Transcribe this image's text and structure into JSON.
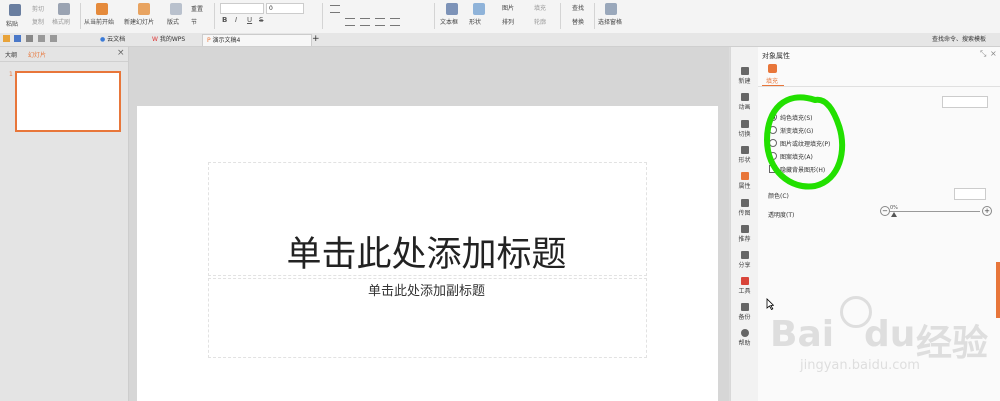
{
  "ribbon": {
    "paste": "粘贴",
    "cut": "剪切",
    "copy": "复制",
    "format_painter": "格式刷",
    "from_current": "从当前开始",
    "new_slide": "新建幻灯片",
    "layout": "版式",
    "section": "节",
    "reset": "重置",
    "font_size": "0",
    "bold": "B",
    "italic": "I",
    "underline": "U",
    "strike": "S",
    "textbox": "文本框",
    "shape": "形状",
    "picture": "图片",
    "fill": "填充",
    "arrange": "排列",
    "outline": "轮廓",
    "find": "查找",
    "replace": "替换",
    "select_pane": "选择窗格"
  },
  "tabbar": {
    "tabs": [
      {
        "label": "云文档"
      },
      {
        "label": "我的WPS"
      },
      {
        "label": "演示文稿4"
      }
    ],
    "add": "+",
    "search": "查找命令、搜索模板"
  },
  "leftpane": {
    "tab_outline": "大纲",
    "tab_slides": "幻灯片",
    "slide_number": "1",
    "close": "×"
  },
  "slide": {
    "title": "单击此处添加标题",
    "subtitle": "单击此处添加副标题"
  },
  "sidetools": [
    {
      "label": "新建"
    },
    {
      "label": "动画"
    },
    {
      "label": "切换"
    },
    {
      "label": "形状"
    },
    {
      "label": "属性"
    },
    {
      "label": "传图"
    },
    {
      "label": "推荐"
    },
    {
      "label": "分享"
    },
    {
      "label": "工具"
    },
    {
      "label": "备份"
    },
    {
      "label": "帮助"
    }
  ],
  "panel": {
    "title": "对象属性",
    "fill_tab": "填充",
    "options": [
      {
        "label": "纯色填充(S)",
        "selected": true
      },
      {
        "label": "渐变填充(G)",
        "selected": false
      },
      {
        "label": "图片或纹理填充(P)",
        "selected": false
      },
      {
        "label": "图案填充(A)",
        "selected": false
      }
    ],
    "hide_bg": "隐藏背景图形(H)",
    "color_label": "颜色(C)",
    "transparency_label": "透明度(T)",
    "transparency_value": "0%",
    "minus": "−",
    "plus": "+"
  },
  "watermark": {
    "brand_a": "Bai",
    "brand_b": "du",
    "brand_c": "经验",
    "url": "jingyan.baidu.com"
  },
  "colors": {
    "accent": "#e8763a",
    "annotation": "#22e000"
  }
}
